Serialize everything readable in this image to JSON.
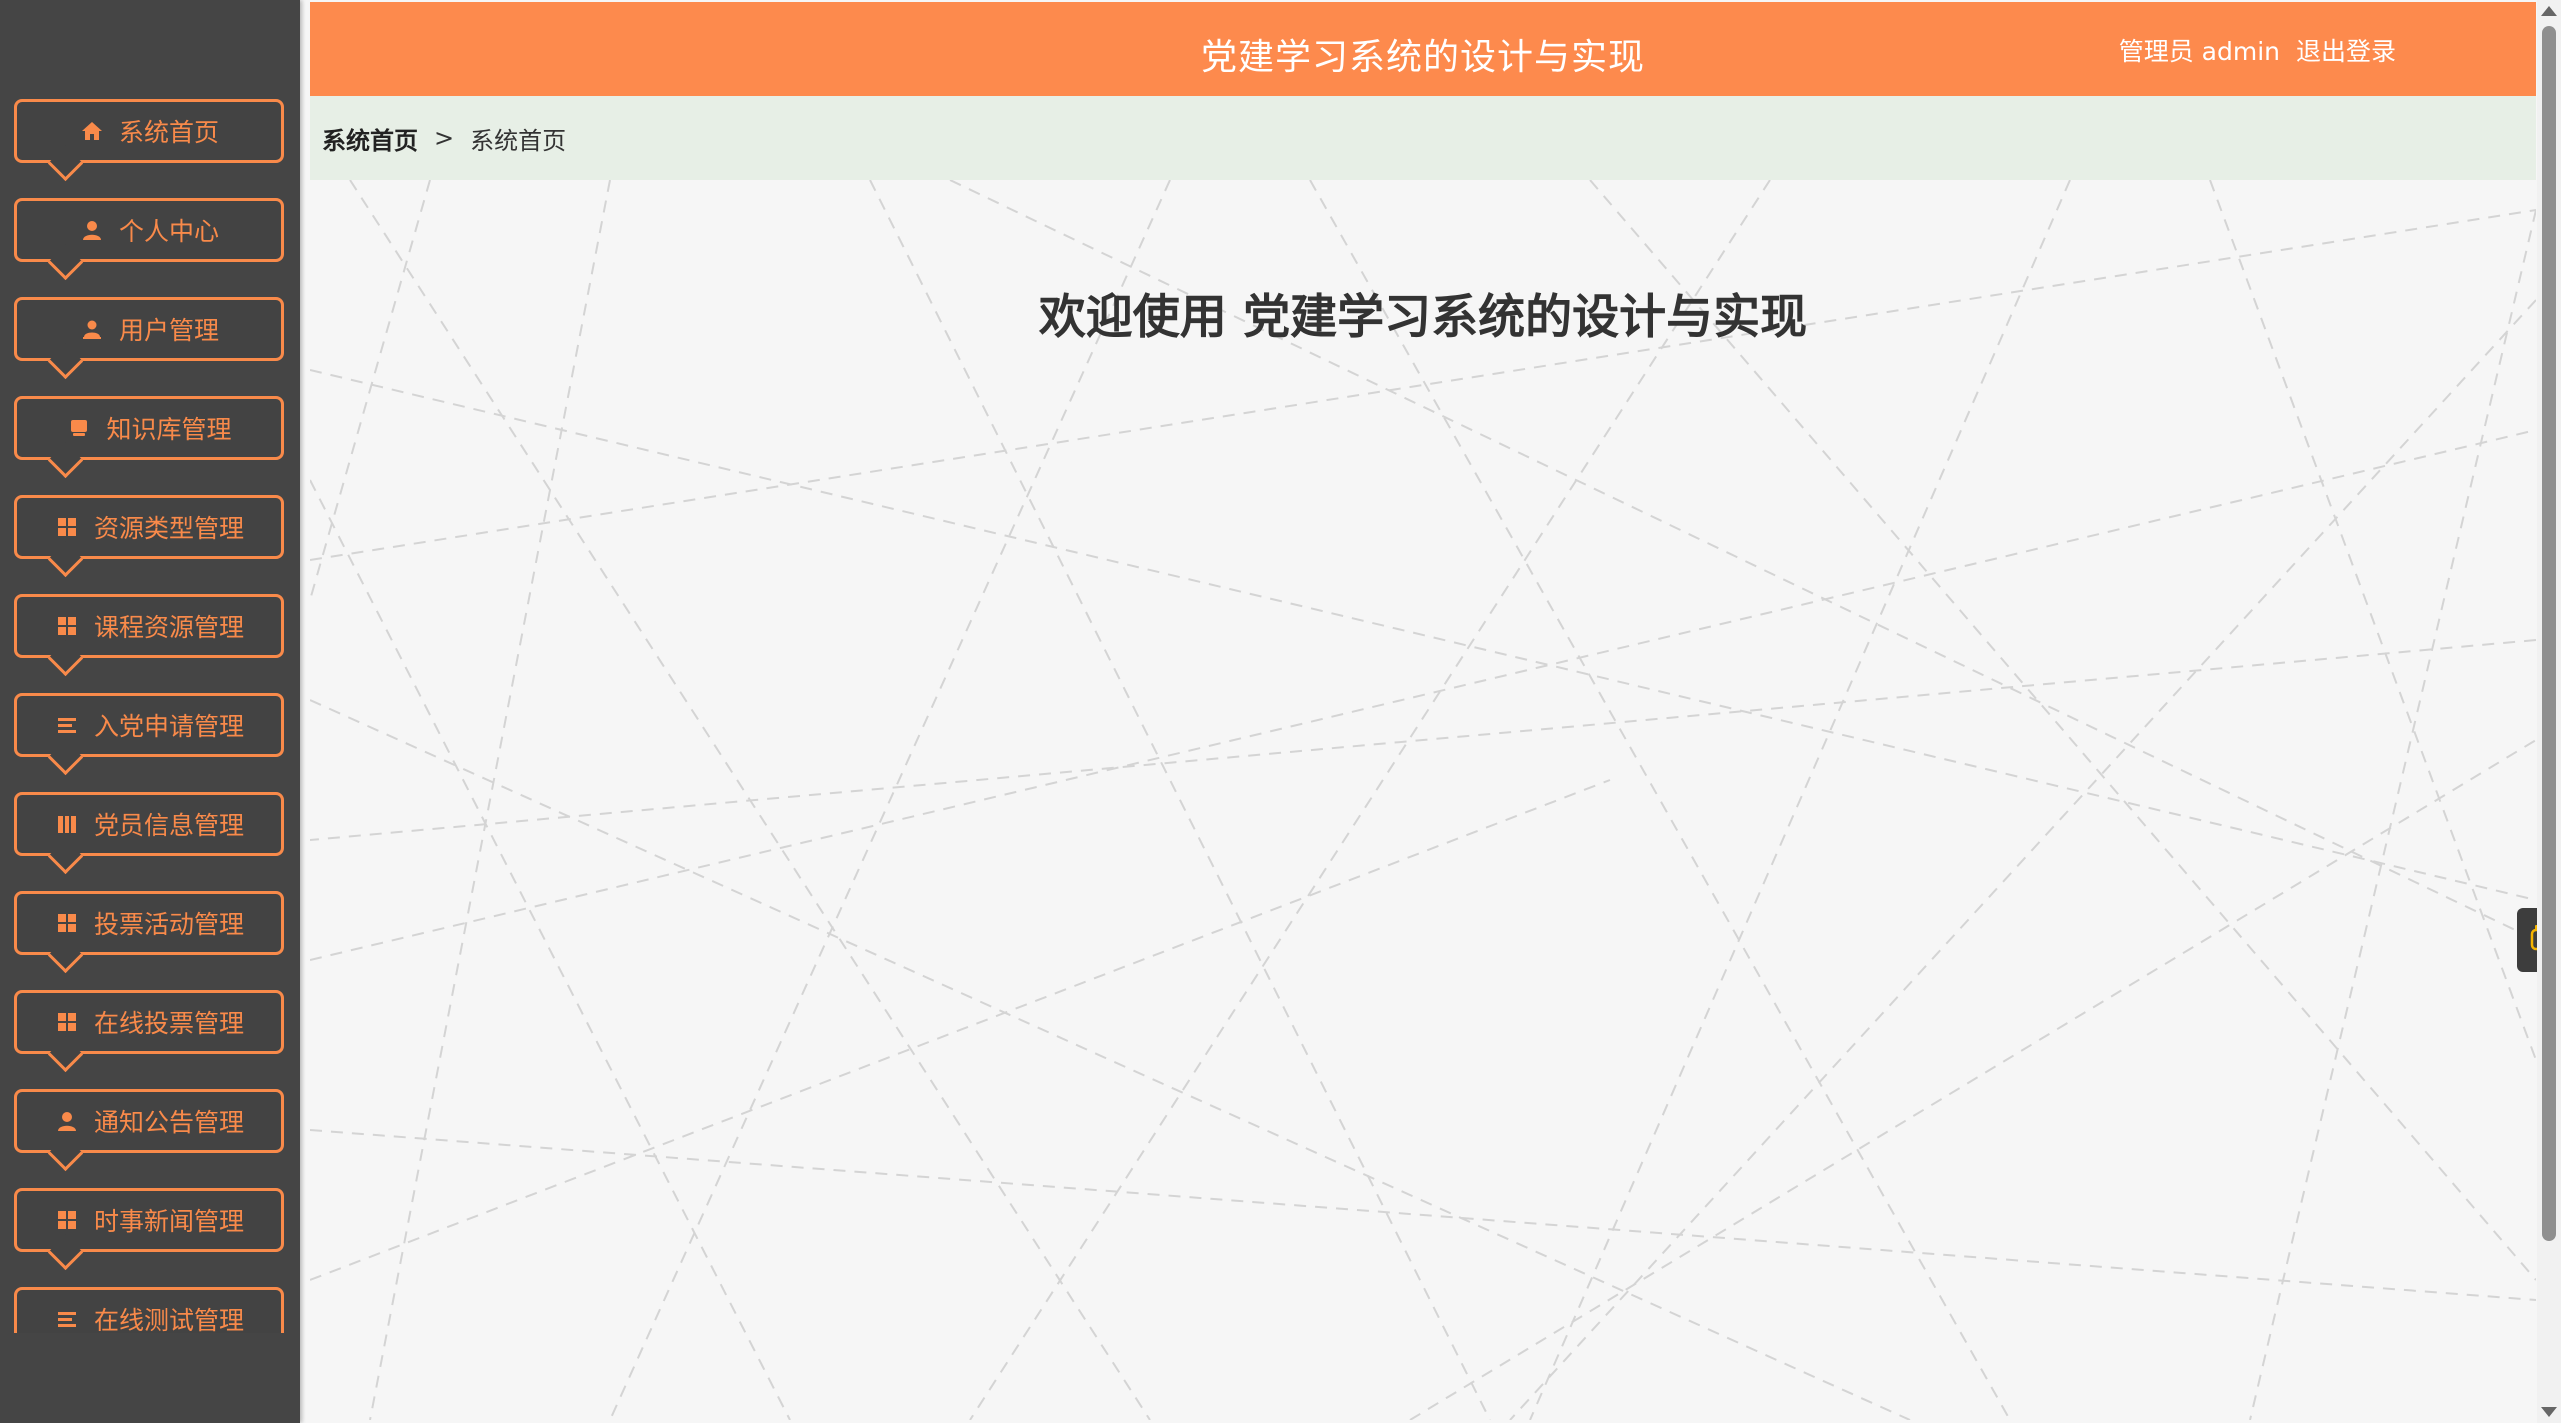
{
  "header": {
    "title": "党建学习系统的设计与实现",
    "user_role": "管理员 admin",
    "logout_label": "退出登录"
  },
  "breadcrumb": {
    "root": "系统首页",
    "separator": ">",
    "current": "系统首页"
  },
  "main": {
    "welcome": "欢迎使用 党建学习系统的设计与实现"
  },
  "sidebar": {
    "items": [
      {
        "label": "系统首页",
        "icon": "home-icon"
      },
      {
        "label": "个人中心",
        "icon": "user-icon"
      },
      {
        "label": "用户管理",
        "icon": "user-icon"
      },
      {
        "label": "知识库管理",
        "icon": "book-icon"
      },
      {
        "label": "资源类型管理",
        "icon": "grid-icon"
      },
      {
        "label": "课程资源管理",
        "icon": "grid-icon"
      },
      {
        "label": "入党申请管理",
        "icon": "list-icon"
      },
      {
        "label": "党员信息管理",
        "icon": "chart-icon"
      },
      {
        "label": "投票活动管理",
        "icon": "grid-icon"
      },
      {
        "label": "在线投票管理",
        "icon": "grid-icon"
      },
      {
        "label": "通知公告管理",
        "icon": "user-icon"
      },
      {
        "label": "时事新闻管理",
        "icon": "grid-icon"
      },
      {
        "label": "在线测试管理",
        "icon": "list-icon"
      }
    ]
  },
  "colors": {
    "accent": "#fd8a4d",
    "sidebar_bg": "#454545",
    "breadcrumb_bg": "#e7efe6",
    "content_bg": "#f6f6f6"
  }
}
